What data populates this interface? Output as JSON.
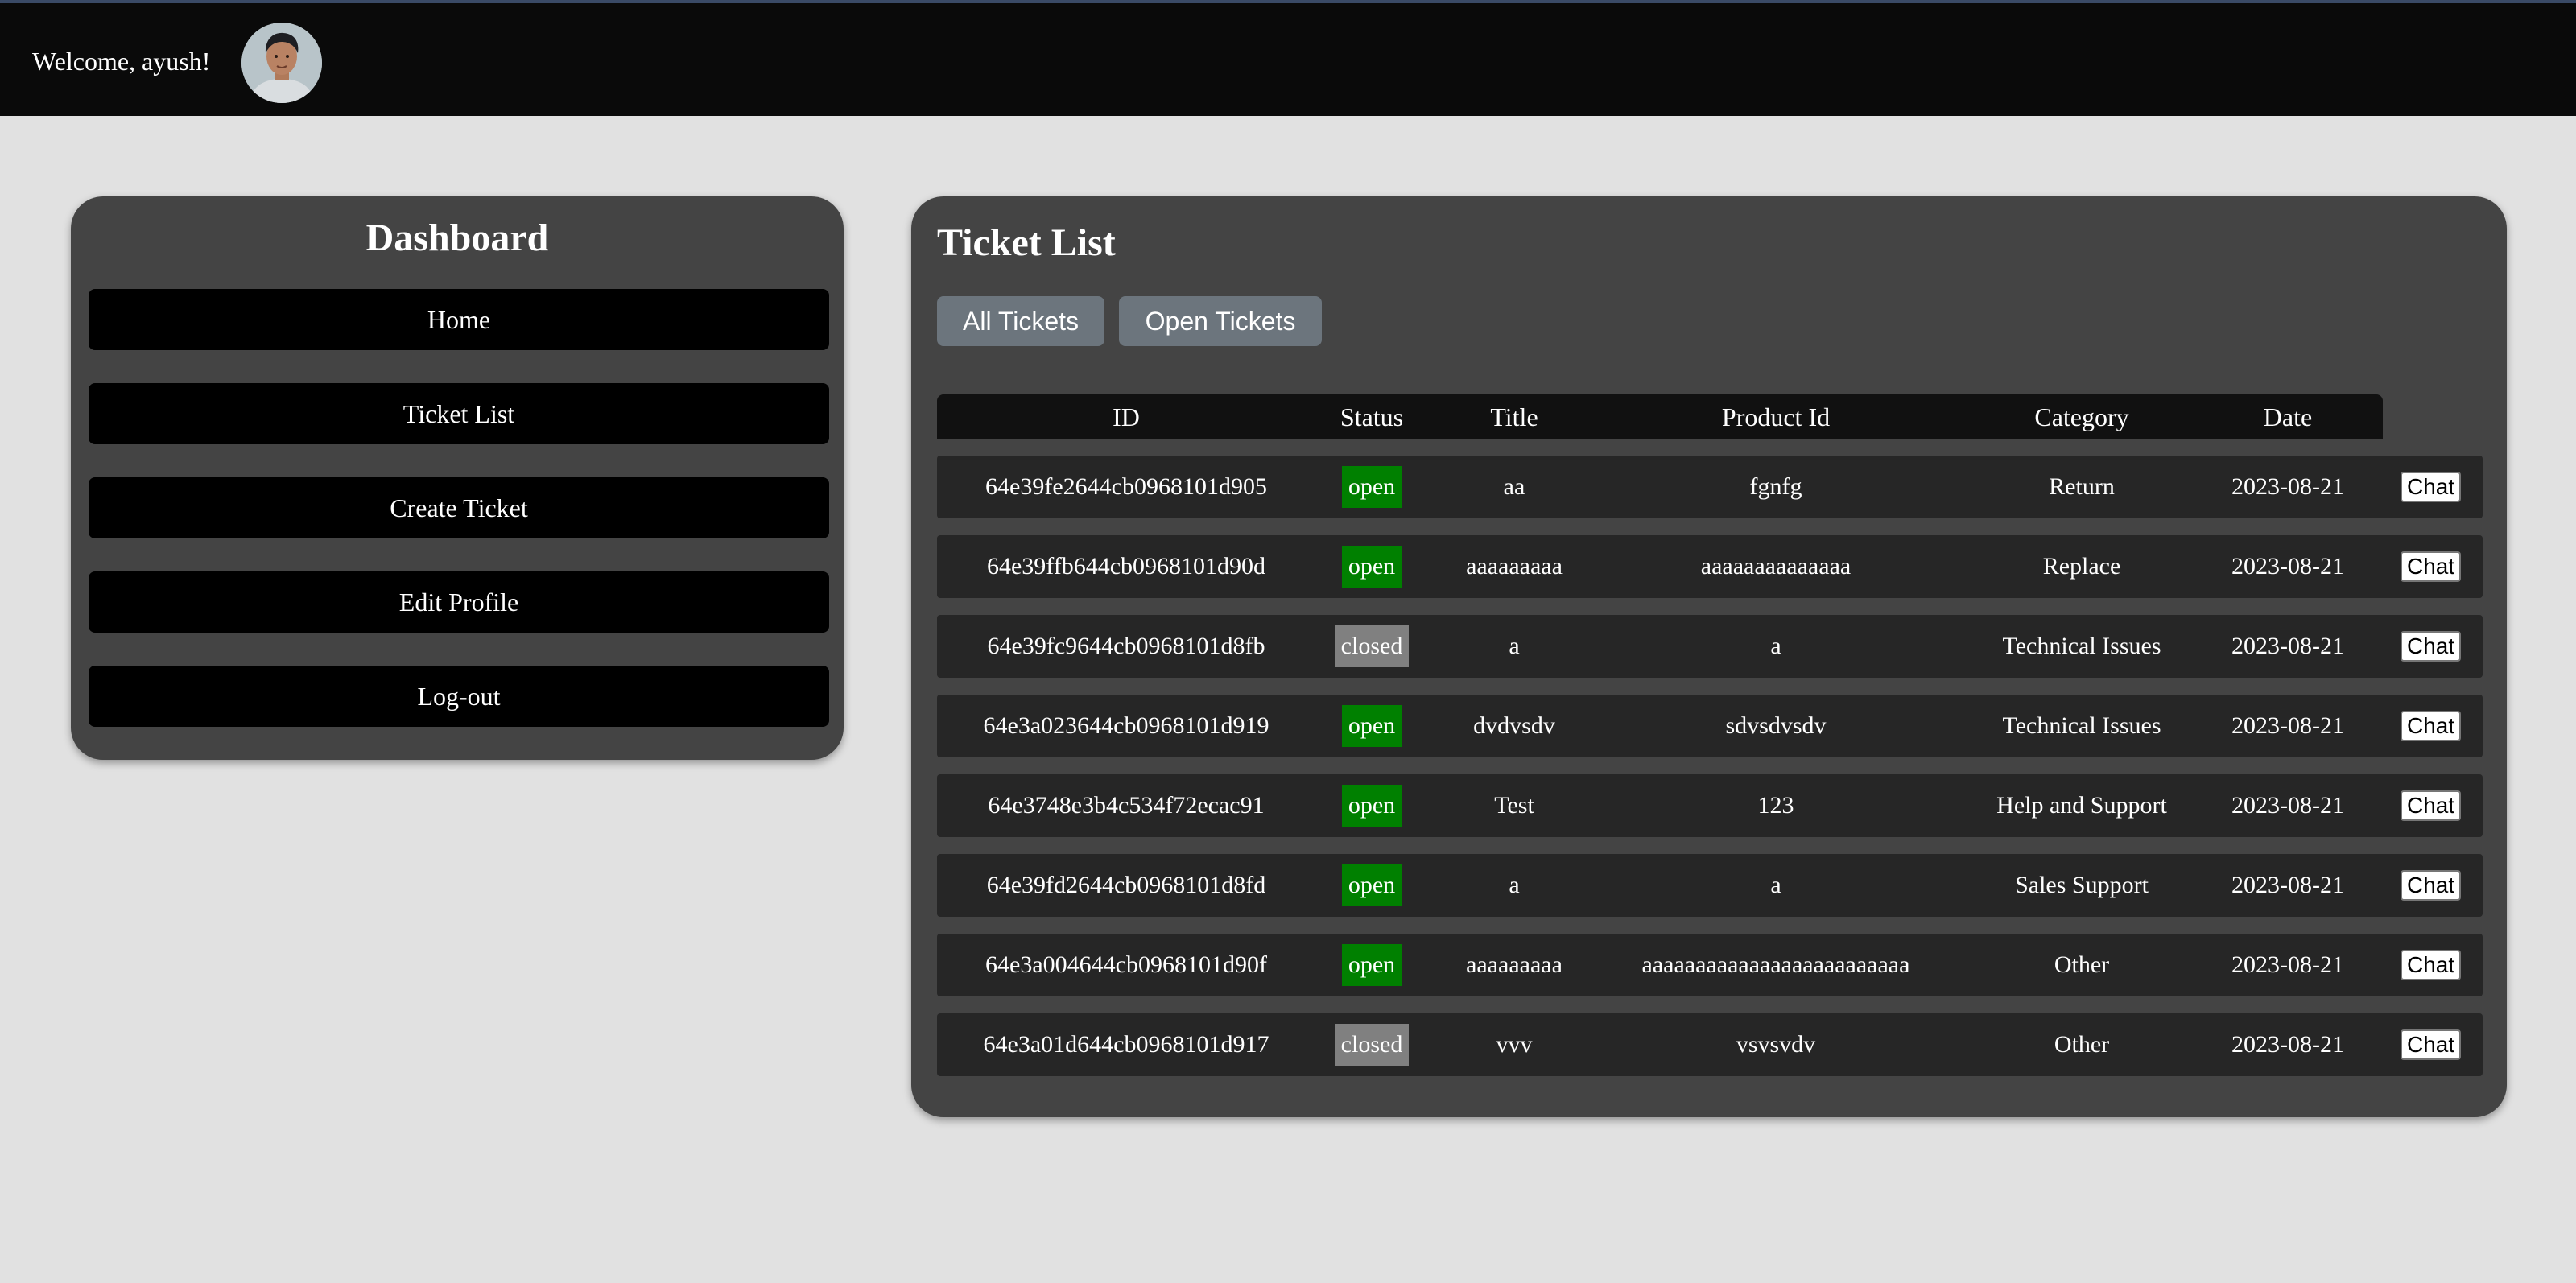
{
  "header": {
    "welcome_text": "Welcome, ayush!"
  },
  "sidebar": {
    "title": "Dashboard",
    "items": [
      {
        "label": "Home"
      },
      {
        "label": "Ticket List"
      },
      {
        "label": "Create Ticket"
      },
      {
        "label": "Edit Profile"
      },
      {
        "label": "Log-out"
      }
    ]
  },
  "main": {
    "title": "Ticket List",
    "filters": [
      {
        "label": "All Tickets"
      },
      {
        "label": "Open Tickets"
      }
    ],
    "columns": [
      "ID",
      "Status",
      "Title",
      "Product Id",
      "Category",
      "Date"
    ],
    "chat_label": "Chat",
    "rows": [
      {
        "id": "64e39fe2644cb0968101d905",
        "status": "open",
        "title": "aa",
        "product_id": "fgnfg",
        "category": "Return",
        "date": "2023-08-21"
      },
      {
        "id": "64e39ffb644cb0968101d90d",
        "status": "open",
        "title": "aaaaaaaaa",
        "product_id": "aaaaaaaaaaaaaa",
        "category": "Replace",
        "date": "2023-08-21"
      },
      {
        "id": "64e39fc9644cb0968101d8fb",
        "status": "closed",
        "title": "a",
        "product_id": "a",
        "category": "Technical Issues",
        "date": "2023-08-21"
      },
      {
        "id": "64e3a023644cb0968101d919",
        "status": "open",
        "title": "dvdvsdv",
        "product_id": "sdvsdvsdv",
        "category": "Technical Issues",
        "date": "2023-08-21"
      },
      {
        "id": "64e3748e3b4c534f72ecac91",
        "status": "open",
        "title": "Test",
        "product_id": "123",
        "category": "Help and Support",
        "date": "2023-08-21"
      },
      {
        "id": "64e39fd2644cb0968101d8fd",
        "status": "open",
        "title": "a",
        "product_id": "a",
        "category": "Sales Support",
        "date": "2023-08-21"
      },
      {
        "id": "64e3a004644cb0968101d90f",
        "status": "open",
        "title": "aaaaaaaaa",
        "product_id": "aaaaaaaaaaaaaaaaaaaaaaaaa",
        "category": "Other",
        "date": "2023-08-21"
      },
      {
        "id": "64e3a01d644cb0968101d917",
        "status": "closed",
        "title": "vvv",
        "product_id": "vsvsvdv",
        "category": "Other",
        "date": "2023-08-21"
      }
    ]
  },
  "colors": {
    "open": "#008000",
    "closed": "#808080",
    "panel": "#444444",
    "row": "#262626"
  }
}
